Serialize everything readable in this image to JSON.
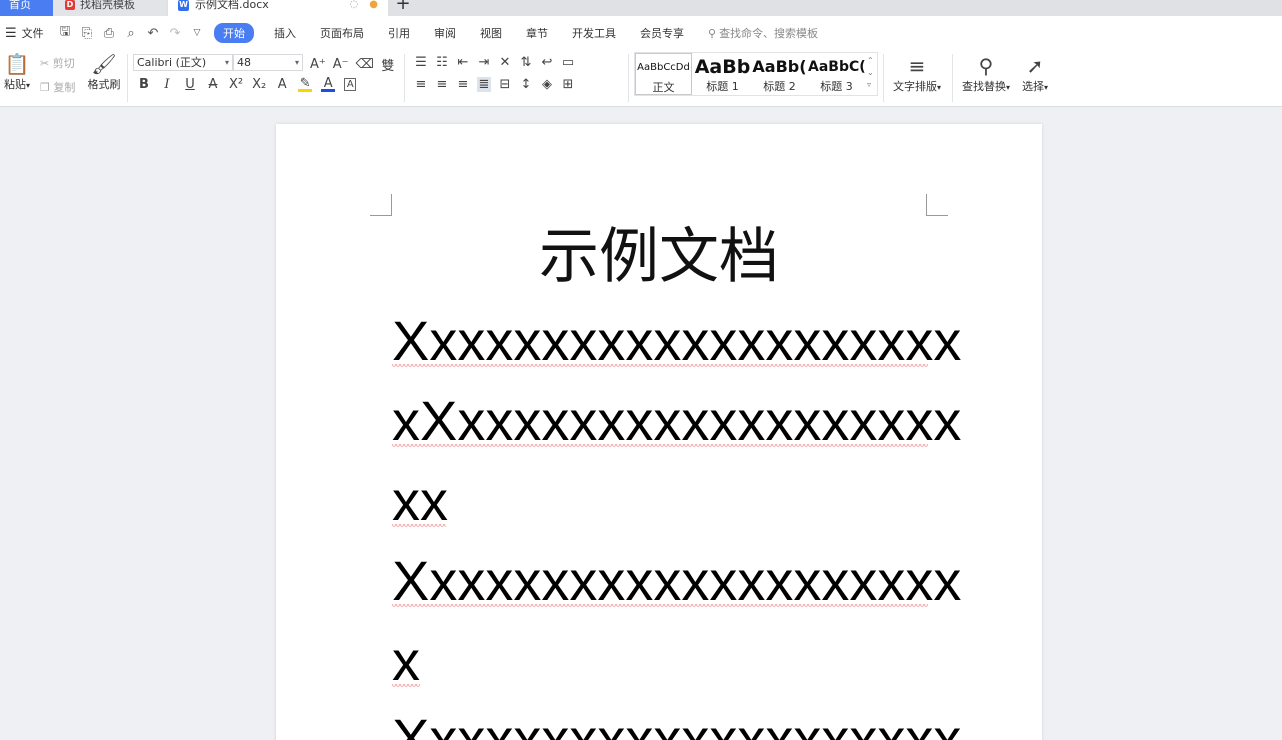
{
  "tabs": {
    "home": "首页",
    "templates": "找稻壳模板",
    "document": "示例文档.docx",
    "add": "+"
  },
  "menu": {
    "file": "文件",
    "items": [
      "开始",
      "插入",
      "页面布局",
      "引用",
      "审阅",
      "视图",
      "章节",
      "开发工具",
      "会员专享"
    ],
    "search_placeholder": "查找命令、搜索模板"
  },
  "ribbon": {
    "paste": "粘贴",
    "cut": "剪切",
    "copy": "复制",
    "format_painter": "格式刷",
    "font_name": "Calibri (正文)",
    "font_size": "48",
    "styles": [
      {
        "preview": "AaBbCcDd",
        "label": "正文"
      },
      {
        "preview": "AaBb",
        "label": "标题 1"
      },
      {
        "preview": "AaBb(",
        "label": "标题 2"
      },
      {
        "preview": "AaBbC(",
        "label": "标题 3"
      }
    ],
    "text_layout": "文字排版",
    "find_replace": "查找替换",
    "select": "选择"
  },
  "document": {
    "title": "示例文档",
    "lines": [
      "Xxxxxxxxxxxxxxxxxxxx",
      "xXxxxxxxxxxxxxxxxxxx",
      "xx",
      "Xxxxxxxxxxxxxxxxxxxx",
      "x",
      "Xxxxxxxxxxxxxxxxxxxx"
    ]
  },
  "colors": {
    "accent": "#4a7df2",
    "font_color_underline": "#1a4fe0",
    "highlight_underline": "#f5d800",
    "spell_error": "#e0393e"
  }
}
